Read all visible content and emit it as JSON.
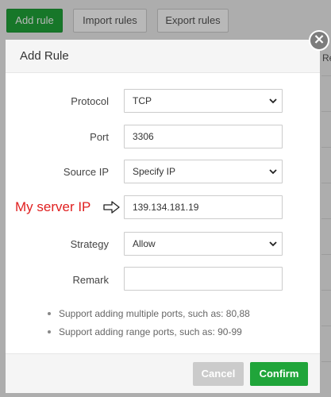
{
  "toolbar": {
    "add_rule": "Add rule",
    "import_rules": "Import rules",
    "export_rules": "Export rules"
  },
  "background": {
    "right_text": "Re"
  },
  "modal": {
    "title": "Add Rule",
    "close_icon": "close-icon",
    "fields": {
      "protocol": {
        "label": "Protocol",
        "value": "TCP"
      },
      "port": {
        "label": "Port",
        "value": "3306"
      },
      "source_ip": {
        "label": "Source IP",
        "value": "Specify IP"
      },
      "ip_address": {
        "value": "139.134.181.19"
      },
      "strategy": {
        "label": "Strategy",
        "value": "Allow"
      },
      "remark": {
        "label": "Remark",
        "value": ""
      }
    },
    "annotation": "My server IP",
    "tips": [
      "Support adding multiple ports, such as: 80,88",
      "Support adding range ports, such as: 90-99"
    ],
    "cancel": "Cancel",
    "confirm": "Confirm"
  },
  "colors": {
    "accent": "#20a53a",
    "annotation": "#e02020",
    "cancel": "#cbcbcb"
  }
}
